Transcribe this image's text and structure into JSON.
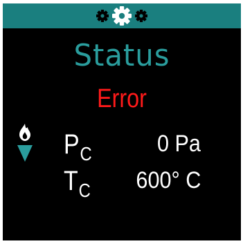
{
  "header": {
    "icons": [
      "small-gear-icon",
      "large-gear-icon",
      "small-gear-icon"
    ]
  },
  "screen": {
    "title": "Status",
    "status": "Error"
  },
  "indicators": {
    "left_icons": [
      "flame-icon",
      "down-triangle-icon"
    ]
  },
  "readings": {
    "pressure": {
      "symbol": "P",
      "subscript": "C",
      "value": "0 Pa"
    },
    "temperature": {
      "symbol": "T",
      "subscript": "C",
      "value": "600° C"
    }
  },
  "colors": {
    "header_bg": "#1a7f7f",
    "title": "#2a9d9d",
    "error": "#ff1a1a",
    "screen_bg": "#000000",
    "text": "#ffffff",
    "indicator": "#2a9d9d"
  }
}
